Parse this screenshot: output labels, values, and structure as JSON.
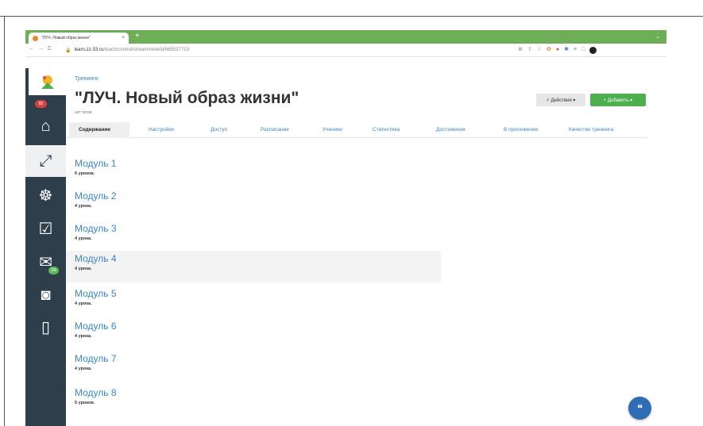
{
  "browser": {
    "tab_title": "\"ЛУЧ. Новый образ жизни\"",
    "tab_close": "×",
    "new_tab": "+",
    "tabbar_chevron": "⌄",
    "nav_back": "←",
    "nav_forward": "→",
    "nav_reload": "C",
    "lock_icon": "🔒",
    "url_host": "learn.zz-33.ru",
    "url_path": "/teach/control/stream/view/id/665527713",
    "addr_icons": [
      "⊕",
      "⇧",
      "☆",
      "✿",
      "●",
      "✱",
      "≡",
      "□"
    ]
  },
  "sidebar": {
    "badge_count": "85",
    "badge_percent": "1%",
    "items": [
      {
        "icon": "home-icon",
        "glyph": "⌂"
      },
      {
        "icon": "chart-icon",
        "glyph": "⤢"
      },
      {
        "icon": "users-icon",
        "glyph": "☸"
      },
      {
        "icon": "tasks-icon",
        "glyph": "☑"
      },
      {
        "icon": "mail-icon",
        "glyph": "✉"
      },
      {
        "icon": "safe-icon",
        "glyph": "◙"
      },
      {
        "icon": "phone-icon",
        "glyph": "▯"
      }
    ]
  },
  "main": {
    "breadcrumb": "Тренинги",
    "title": "\"ЛУЧ. Новый образ жизни\"",
    "tags": "нет тегов",
    "actions_button": "⚡ Действия ▾",
    "add_button": "+ Добавить ▾",
    "tabs": [
      {
        "label": "Содержание",
        "active": true
      },
      {
        "label": "Настройки"
      },
      {
        "label": "Доступ"
      },
      {
        "label": "Расписание"
      },
      {
        "label": "Ученики"
      },
      {
        "label": "Статистика"
      },
      {
        "label": "Достижения"
      },
      {
        "label": "В приложении"
      },
      {
        "label": "Качество тренинга"
      }
    ],
    "modules": [
      {
        "title": "Модуль 1",
        "lessons": "6 уроков."
      },
      {
        "title": "Модуль 2",
        "lessons": "4 урока."
      },
      {
        "title": "Модуль 3",
        "lessons": "4 урока."
      },
      {
        "title": "Модуль 4",
        "lessons": "4 урока.",
        "highlighted": true
      },
      {
        "title": "Модуль 5",
        "lessons": "4 урока."
      },
      {
        "title": "Модуль 6",
        "lessons": "4 урока."
      },
      {
        "title": "Модуль 7",
        "lessons": "4 урока."
      },
      {
        "title": "Модуль 8",
        "lessons": "5 уроков."
      }
    ]
  },
  "chat_icon": "❝"
}
